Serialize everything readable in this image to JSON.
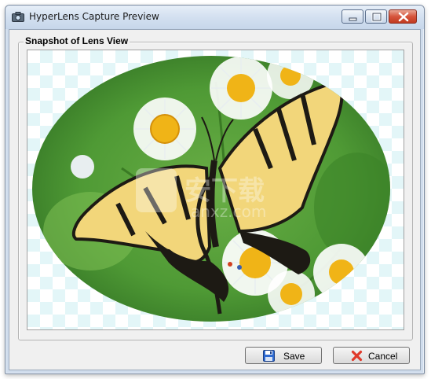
{
  "window": {
    "title": "HyperLens Capture Preview",
    "app_icon": "camera-icon"
  },
  "title_buttons": {
    "minimize_icon": "minimize-icon",
    "maximize_icon": "maximize-icon",
    "close_icon": "close-icon"
  },
  "group": {
    "label": "Snapshot of Lens View"
  },
  "preview": {
    "content": "butterfly-on-daisies-photo",
    "mask_shape": "ellipse",
    "background": "transparency-checkerboard",
    "watermark": "安下载 anxz.com"
  },
  "buttons": {
    "save_label": "Save",
    "save_icon": "floppy-disk-icon",
    "cancel_label": "Cancel",
    "cancel_icon": "red-x-icon"
  },
  "colors": {
    "titlebar": "#d3e0f0",
    "close_button": "#c13a20",
    "client_bg": "#f0f0f0",
    "checker": "#e3f6f8",
    "foliage": "#4f9a35"
  }
}
